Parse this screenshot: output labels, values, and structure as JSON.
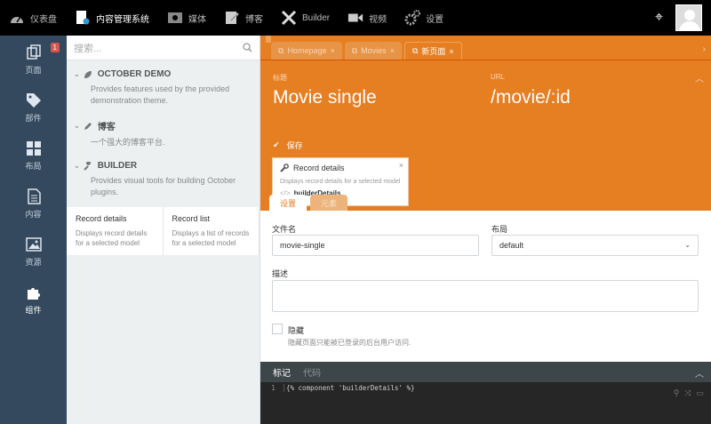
{
  "topbar": {
    "items": [
      {
        "label": "仪表盘",
        "icon": "dashboard-icon"
      },
      {
        "label": "内容管理系统",
        "icon": "cms-icon",
        "active": true
      },
      {
        "label": "媒体",
        "icon": "media-icon"
      },
      {
        "label": "博客",
        "icon": "blog-icon"
      },
      {
        "label": "Builder",
        "icon": "builder-icon"
      },
      {
        "label": "视频",
        "icon": "video-icon"
      },
      {
        "label": "设置",
        "icon": "settings-icon"
      }
    ]
  },
  "leftnav": {
    "items": [
      {
        "label": "页面",
        "icon": "pages-icon",
        "badge": "1"
      },
      {
        "label": "部件",
        "icon": "partials-icon"
      },
      {
        "label": "布局",
        "icon": "layouts-icon"
      },
      {
        "label": "内容",
        "icon": "content-icon"
      },
      {
        "label": "资源",
        "icon": "assets-icon"
      },
      {
        "label": "组件",
        "icon": "components-icon",
        "active": true
      }
    ]
  },
  "sidepanel": {
    "search_placeholder": "搜索...",
    "groups": [
      {
        "title": "OCTOBER DEMO",
        "desc": "Provides features used by the provided demonstration theme."
      },
      {
        "title": "博客",
        "desc": "一个强大的博客平台."
      },
      {
        "title": "BUILDER",
        "desc": "Provides visual tools for building October plugins."
      }
    ],
    "components": [
      {
        "title": "Record details",
        "desc": "Displays record details for a selected model"
      },
      {
        "title": "Record list",
        "desc": "Displays a list of records for a selected model"
      }
    ]
  },
  "tabs": [
    {
      "label": "Homepage"
    },
    {
      "label": "Movies"
    },
    {
      "label": "新页面",
      "active": true
    }
  ],
  "header": {
    "title_label": "标题",
    "title_value": "Movie single",
    "url_label": "URL",
    "url_value": "/movie/:id",
    "hide_label": "保存"
  },
  "record_card": {
    "title": "Record details",
    "desc": "Displays record details for a selected model",
    "alias_prefix": "</>",
    "alias": "builderDetails"
  },
  "form_tabs": [
    {
      "label": "设置",
      "active": true
    },
    {
      "label": "元素"
    }
  ],
  "form": {
    "filename_label": "文件名",
    "filename_value": "movie-single",
    "layout_label": "布局",
    "layout_value": "default",
    "desc_label": "描述",
    "desc_value": "",
    "hidden_label": "隐藏",
    "hidden_help": "隐藏页面只能被已登录的后台用户访问."
  },
  "editor": {
    "tabs": [
      {
        "label": "标记",
        "active": true
      },
      {
        "label": "代码"
      }
    ],
    "line_number": "1",
    "code": "{% component 'builderDetails' %}"
  },
  "colors": {
    "accent": "#e67e22",
    "sidebar": "#34495e",
    "topbar": "#000000"
  }
}
